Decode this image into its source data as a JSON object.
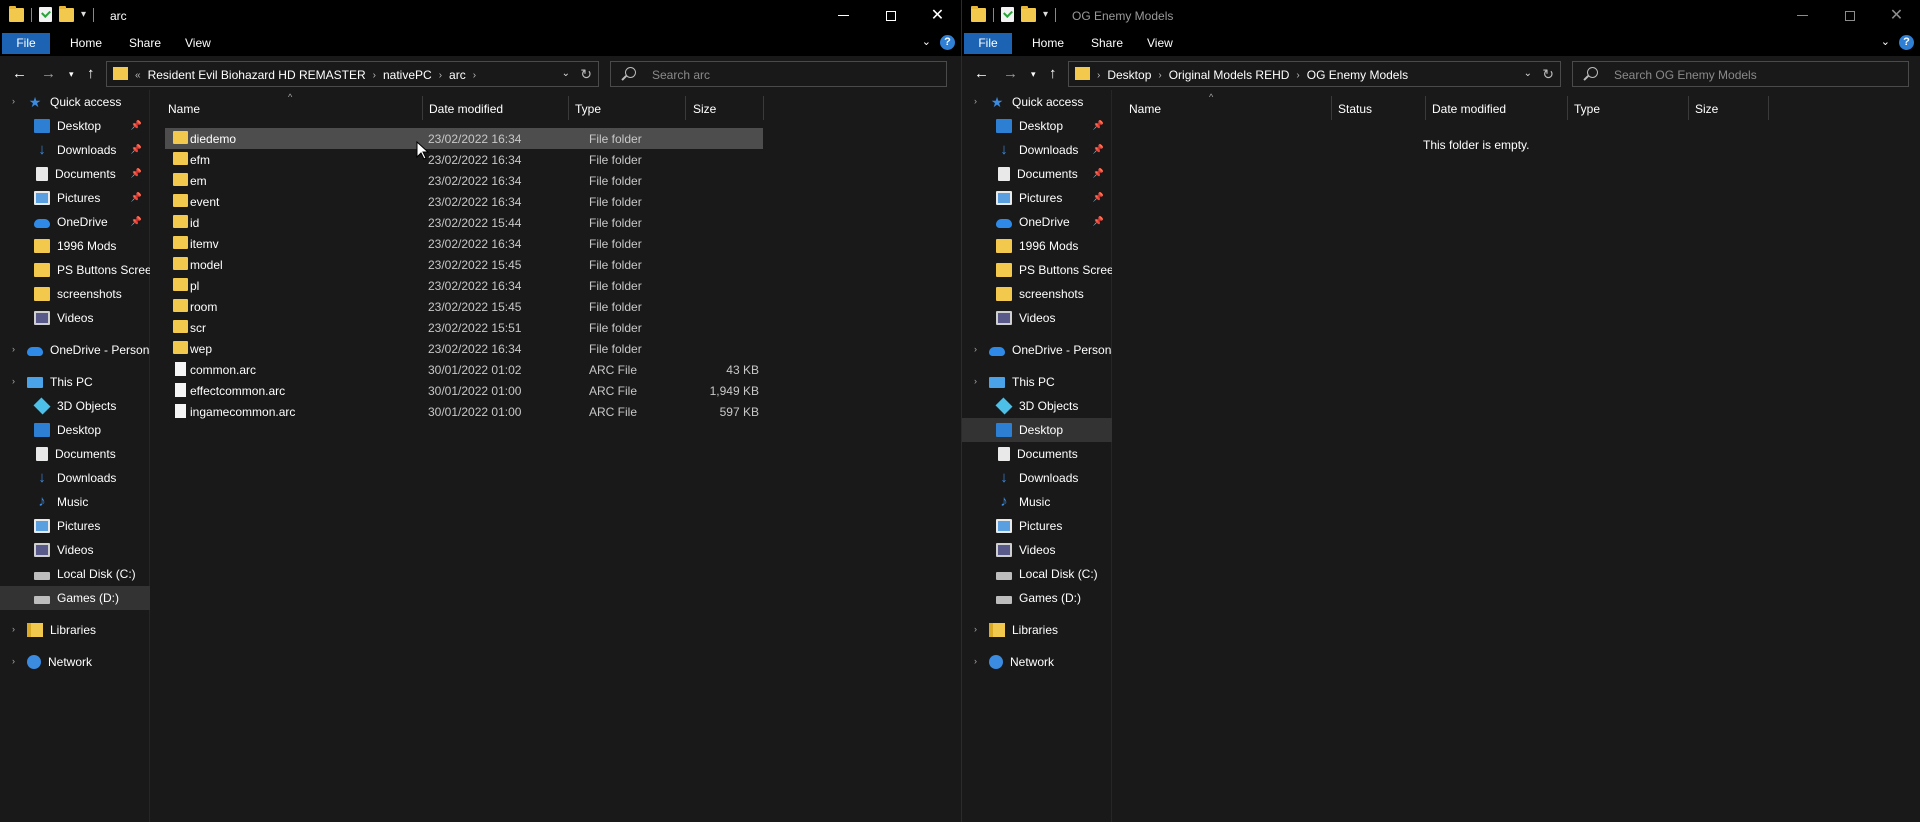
{
  "left": {
    "title": "arc",
    "tabs": {
      "file": "File",
      "home": "Home",
      "share": "Share",
      "view": "View"
    },
    "breadcrumb": {
      "prefix": "«",
      "items": [
        "Resident Evil Biohazard HD REMASTER",
        "nativePC",
        "arc"
      ]
    },
    "search_placeholder": "Search arc",
    "columns": {
      "name": "Name",
      "date": "Date modified",
      "type": "Type",
      "size": "Size"
    },
    "files": [
      {
        "name": "diedemo",
        "date": "23/02/2022 16:34",
        "type": "File folder",
        "size": ""
      },
      {
        "name": "efm",
        "date": "23/02/2022 16:34",
        "type": "File folder",
        "size": ""
      },
      {
        "name": "em",
        "date": "23/02/2022 16:34",
        "type": "File folder",
        "size": ""
      },
      {
        "name": "event",
        "date": "23/02/2022 16:34",
        "type": "File folder",
        "size": ""
      },
      {
        "name": "id",
        "date": "23/02/2022 15:44",
        "type": "File folder",
        "size": ""
      },
      {
        "name": "itemv",
        "date": "23/02/2022 16:34",
        "type": "File folder",
        "size": ""
      },
      {
        "name": "model",
        "date": "23/02/2022 15:45",
        "type": "File folder",
        "size": ""
      },
      {
        "name": "pl",
        "date": "23/02/2022 16:34",
        "type": "File folder",
        "size": ""
      },
      {
        "name": "room",
        "date": "23/02/2022 15:45",
        "type": "File folder",
        "size": ""
      },
      {
        "name": "scr",
        "date": "23/02/2022 15:51",
        "type": "File folder",
        "size": ""
      },
      {
        "name": "wep",
        "date": "23/02/2022 16:34",
        "type": "File folder",
        "size": ""
      },
      {
        "name": "common.arc",
        "date": "30/01/2022 01:02",
        "type": "ARC File",
        "size": "43 KB"
      },
      {
        "name": "effectcommon.arc",
        "date": "30/01/2022 01:00",
        "type": "ARC File",
        "size": "1,949 KB"
      },
      {
        "name": "ingamecommon.arc",
        "date": "30/01/2022 01:00",
        "type": "ARC File",
        "size": "597 KB"
      }
    ]
  },
  "right": {
    "title": "OG Enemy Models",
    "tabs": {
      "file": "File",
      "home": "Home",
      "share": "Share",
      "view": "View"
    },
    "breadcrumb": {
      "items": [
        "Desktop",
        "Original Models REHD",
        "OG Enemy Models"
      ]
    },
    "search_placeholder": "Search OG Enemy Models",
    "columns": {
      "name": "Name",
      "status": "Status",
      "date": "Date modified",
      "type": "Type",
      "size": "Size"
    },
    "empty_message": "This folder is empty."
  },
  "nav": {
    "quick_access": "Quick access",
    "quick_items": [
      "Desktop",
      "Downloads",
      "Documents",
      "Pictures",
      "OneDrive",
      "1996 Mods",
      "PS Buttons Screenshots",
      "screenshots",
      "Videos"
    ],
    "onedrive_personal": "OneDrive - Personal",
    "this_pc": "This PC",
    "pc_items": [
      "3D Objects",
      "Desktop",
      "Documents",
      "Downloads",
      "Music",
      "Pictures",
      "Videos",
      "Local Disk (C:)",
      "Games  (D:)"
    ],
    "libraries": "Libraries",
    "network": "Network"
  },
  "colors": {
    "accent": "#1c63b3",
    "folder": "#f2c94c",
    "background": "#191919"
  }
}
